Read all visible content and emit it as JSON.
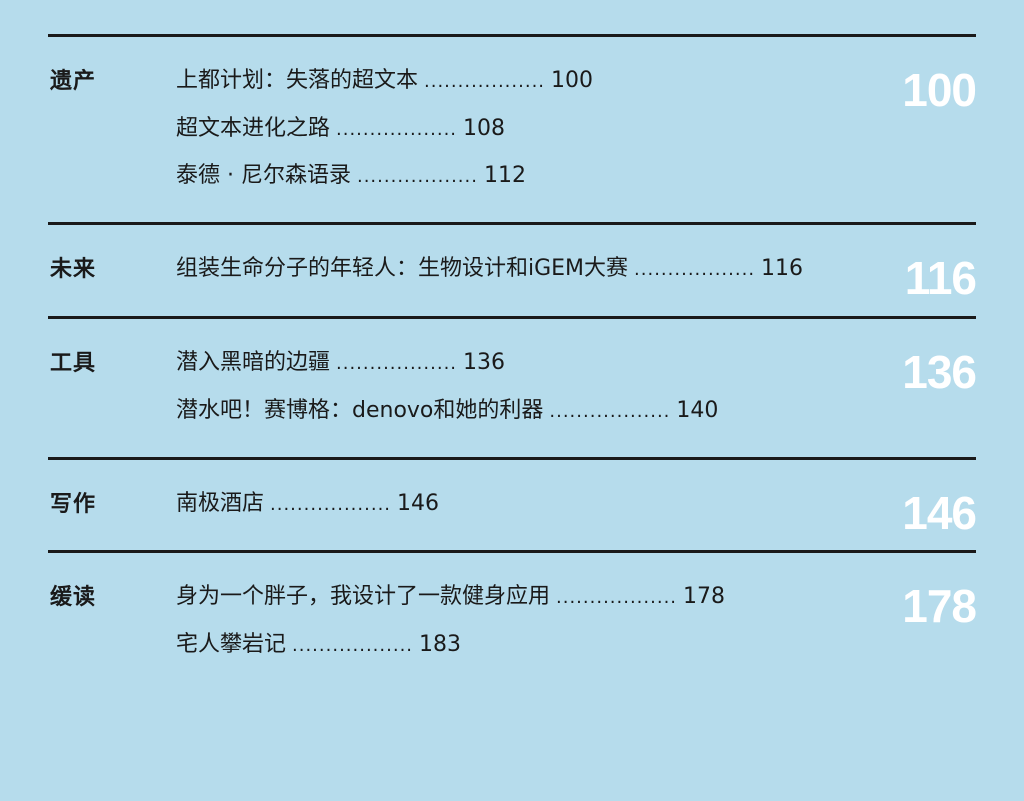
{
  "sections": [
    {
      "category": "遗产",
      "big_page": "100",
      "entries": [
        {
          "title": "上都计划：失落的超文本",
          "dots": "..................",
          "page": "100"
        },
        {
          "title": "超文本进化之路",
          "dots": "..................",
          "page": "108"
        },
        {
          "title": "泰德 · 尼尔森语录",
          "dots": "..................",
          "page": "112"
        }
      ]
    },
    {
      "category": "未来",
      "big_page": "116",
      "entries": [
        {
          "title": "组装生命分子的年轻人：生物设计和iGEM大赛",
          "dots": "..................",
          "page": "116"
        }
      ]
    },
    {
      "category": "工具",
      "big_page": "136",
      "entries": [
        {
          "title": "潜入黑暗的边疆",
          "dots": "..................",
          "page": "136"
        },
        {
          "title": "潜水吧！赛博格：denovo和她的利器",
          "dots": "..................",
          "page": "140"
        }
      ]
    },
    {
      "category": "写作",
      "big_page": "146",
      "entries": [
        {
          "title": "南极酒店",
          "dots": "..................",
          "page": "146"
        }
      ]
    },
    {
      "category": "缓读",
      "big_page": "178",
      "entries": [
        {
          "title": "身为一个胖子，我设计了一款健身应用",
          "dots": "..................",
          "page": "178"
        },
        {
          "title": "宅人攀岩记",
          "dots": "..................",
          "page": "183"
        }
      ]
    }
  ]
}
